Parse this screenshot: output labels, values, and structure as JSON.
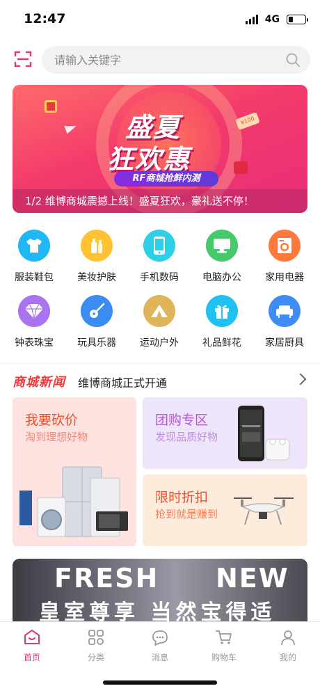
{
  "status_bar": {
    "time": "12:47",
    "network": "4G"
  },
  "search": {
    "placeholder": "请输入关键字"
  },
  "banner": {
    "title_line1": "盛夏",
    "title_line2": "狂欢惠",
    "badge": "RF商城抢鲜内测",
    "tag": "¥100",
    "caption": "1/2 维博商城震撼上线！盛夏狂欢，豪礼送不停！"
  },
  "categories": [
    {
      "label": "服装鞋包",
      "icon": "tshirt-icon",
      "color": "#1fb8f5"
    },
    {
      "label": "美妆护肤",
      "icon": "cosmetics-icon",
      "color": "#ffc233"
    },
    {
      "label": "手机数码",
      "icon": "phone-icon",
      "color": "#2ecfe8"
    },
    {
      "label": "电脑办公",
      "icon": "monitor-icon",
      "color": "#46c96a"
    },
    {
      "label": "家用电器",
      "icon": "washer-icon",
      "color": "#ff7a3a"
    },
    {
      "label": "钟表珠宝",
      "icon": "diamond-icon",
      "color": "#a874f0"
    },
    {
      "label": "玩具乐器",
      "icon": "guitar-icon",
      "color": "#3a8cf2"
    },
    {
      "label": "运动户外",
      "icon": "tent-icon",
      "color": "#e0b45a"
    },
    {
      "label": "礼品鲜花",
      "icon": "gift-icon",
      "color": "#1fc0f2"
    },
    {
      "label": "家居厨具",
      "icon": "sofa-icon",
      "color": "#3e8cf5"
    }
  ],
  "news": {
    "brand": "商城新闻",
    "headline": "维博商城正式开通"
  },
  "promos": {
    "bargain": {
      "title": "我要砍价",
      "subtitle": "淘到理想好物",
      "title_color": "#e8522e",
      "sub_color": "#f08a7a"
    },
    "group": {
      "title": "团购专区",
      "subtitle": "发现品质好物",
      "title_color": "#b25ad6",
      "sub_color": "#c18ee0"
    },
    "discount": {
      "title": "限时折扣",
      "subtitle": "抢到就是赚到",
      "title_color": "#e8522e",
      "sub_color": "#f0805a"
    }
  },
  "fresh_banner": {
    "word1": "FRESH",
    "word2": "NEW",
    "slogan": "皇室尊享  当然宝得适"
  },
  "tabs": [
    {
      "label": "首页",
      "icon": "home-icon",
      "active": true
    },
    {
      "label": "分类",
      "icon": "category-icon",
      "active": false
    },
    {
      "label": "消息",
      "icon": "message-icon",
      "active": false
    },
    {
      "label": "购物车",
      "icon": "cart-icon",
      "active": false
    },
    {
      "label": "我的",
      "icon": "user-icon",
      "active": false
    }
  ],
  "colors": {
    "accent": "#e8366a",
    "inactive_tab": "#999999"
  }
}
